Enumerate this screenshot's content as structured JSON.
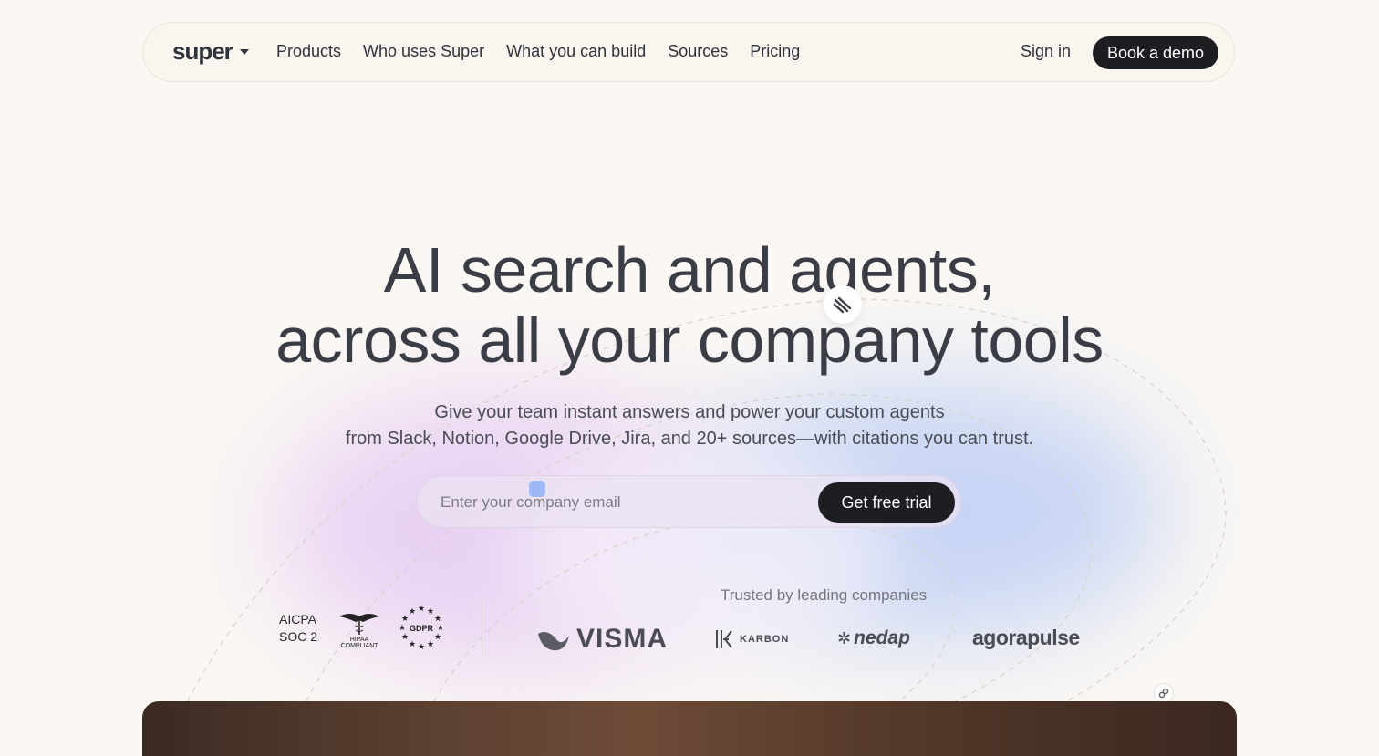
{
  "nav": {
    "logo": "super",
    "links": [
      "Products",
      "Who uses Super",
      "What you can build",
      "Sources",
      "Pricing"
    ],
    "sign_in": "Sign in",
    "book_demo": "Book a demo"
  },
  "hero": {
    "headline_line1": "AI search and agents,",
    "headline_line2": "across all your company tools",
    "subline1": "Give your team instant answers and power your custom agents",
    "subline2": "from Slack, Notion, Google Drive, Jira, and 20+ sources—with citations you can trust."
  },
  "signup": {
    "email_placeholder": "Enter your company email",
    "email_value": "",
    "cta": "Get free trial"
  },
  "compliance": {
    "aicpa_line1": "AICPA",
    "aicpa_line2": "SOC 2",
    "hipaa_line1": "HIPAA",
    "hipaa_line2": "COMPLIANT",
    "gdpr": "GDPR"
  },
  "trusted": {
    "label": "Trusted by leading companies",
    "logos": [
      "VISMA",
      "KARBON",
      "nedap",
      "agorapulse"
    ]
  },
  "colors": {
    "background": "#fbf8f4",
    "dark_button": "#1d1e22",
    "text": "#2f333c"
  }
}
